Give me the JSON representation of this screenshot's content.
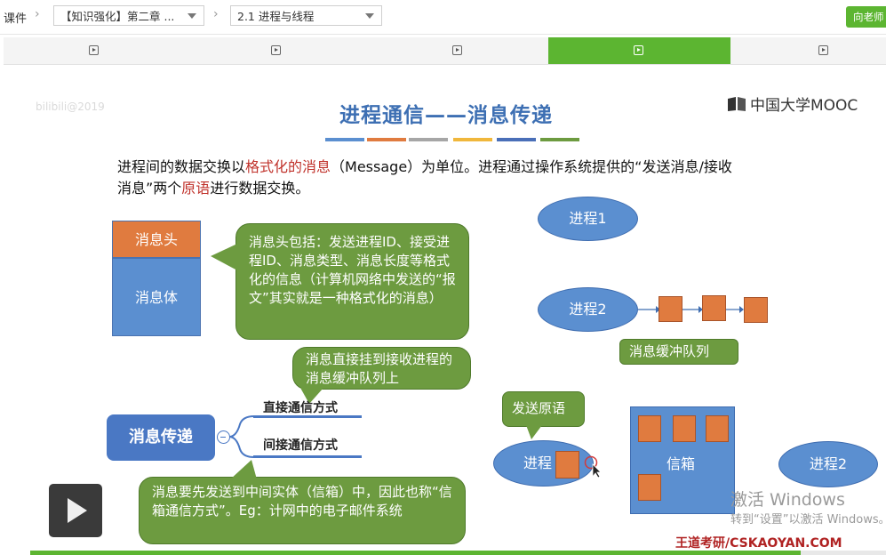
{
  "topbar": {
    "home_label": "课件",
    "chapter_dropdown": "【知识强化】第二章 ...",
    "section_dropdown": "2.1 进程与线程",
    "ask_button": "向老师"
  },
  "tabs": [
    {
      "icon": "video-icon",
      "active": false
    },
    {
      "icon": "video-icon",
      "active": false
    },
    {
      "icon": "video-icon",
      "active": false
    },
    {
      "icon": "video-icon",
      "active": true
    },
    {
      "icon": "video-icon",
      "active": false
    }
  ],
  "slide": {
    "watermark": "bilibili@2019",
    "logo": "中国大学MOOC",
    "title": "进程通信——消息传递",
    "title_bar_colors": [
      "#5b8fd0",
      "#e07b3f",
      "#a6a6a6",
      "#f0b73c",
      "#4a6fb8",
      "#6d9b40"
    ],
    "intro_line1_a": "进程间的数据交换以",
    "intro_line1_red": "格式化的消息",
    "intro_line1_b": "（Message）为单位。进程通过操作系统提供的“发送消息/接收",
    "intro_line2_a": "消息”两个",
    "intro_line2_red": "原语",
    "intro_line2_b": "进行数据交换。",
    "box_head": "消息头",
    "box_body": "消息体",
    "callout_header": "消息头包括：发送进程ID、接受进程ID、消息类型、消息长度等格式化的信息（计算机网络中发送的“报文”其实就是一种格式化的消息）",
    "callout_direct": "消息直接挂到接收进程的消息缓冲队列上",
    "callout_indirect": "消息要先发送到中间实体（信箱）中，因此也称“信箱通信方式”。Eg：计网中的电子邮件系统",
    "node_main": "消息传递",
    "branch_direct": "直接通信方式",
    "branch_indirect": "间接通信方式",
    "process1": "进程1",
    "process2": "进程2",
    "queue_label": "消息缓冲队列",
    "send_primitive": "发送原语",
    "process_sender": "进程",
    "mailbox": "信箱",
    "process2_right": "进程2",
    "site": "王道考研/CSKAOYAN.COM"
  },
  "overlay": {
    "activate_title": "激活 Windows",
    "activate_sub": "转到“设置”以激活 Windows。"
  },
  "player": {
    "progress": 0.9
  }
}
